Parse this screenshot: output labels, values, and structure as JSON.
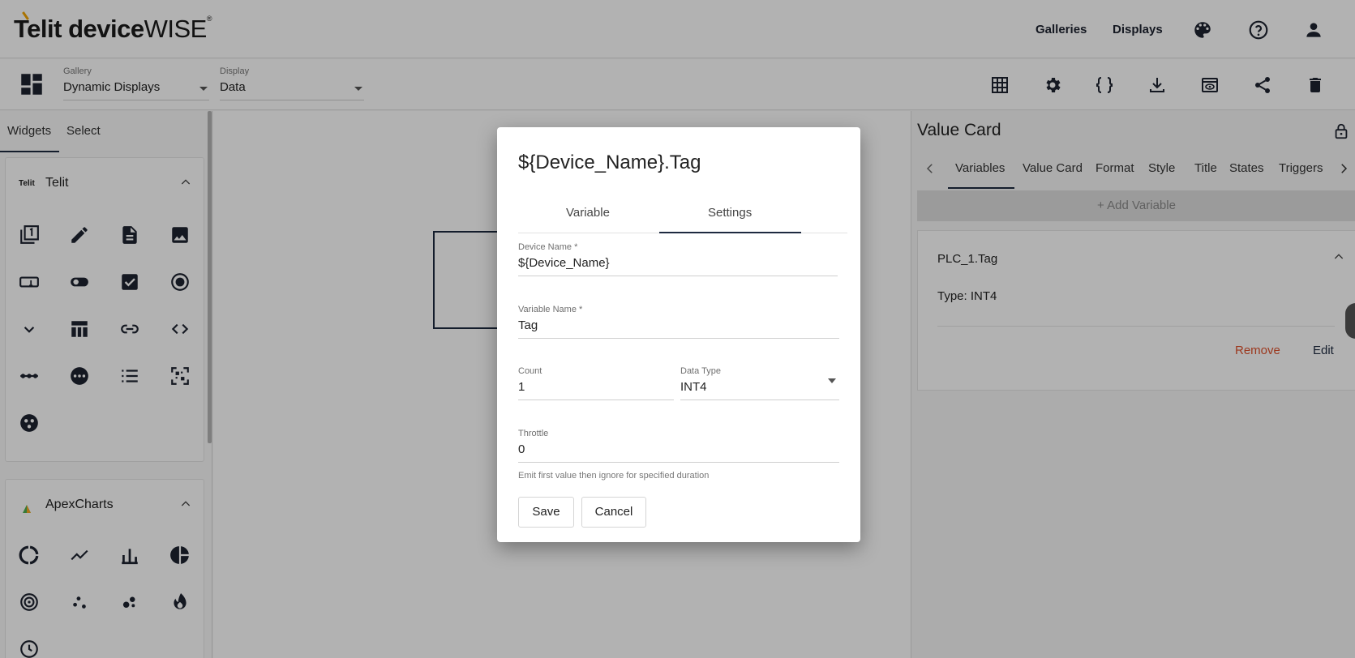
{
  "app": {
    "logo_main": "Telit",
    "logo_device": "device",
    "logo_wise": "WISE",
    "logo_reg": "®"
  },
  "topnav": {
    "galleries": "Galleries",
    "displays": "Displays",
    "icons": [
      "palette-icon",
      "help-icon",
      "account-icon"
    ]
  },
  "toolbar": {
    "gallery": {
      "label": "Gallery",
      "value": "Dynamic Displays"
    },
    "display": {
      "label": "Display",
      "value": "Data"
    },
    "icons": [
      "grid-icon",
      "settings-icon",
      "code-braces-icon",
      "download-icon",
      "preview-icon",
      "share-icon",
      "delete-icon"
    ]
  },
  "left_panel": {
    "tabs": [
      "Widgets",
      "Select"
    ],
    "groups": [
      {
        "title": "Telit",
        "logo_text": "Telit",
        "icons": [
          "copy-icon",
          "pencil-icon",
          "document-icon",
          "image-icon",
          "input-icon",
          "toggle-icon",
          "checkbox-icon",
          "radio-icon",
          "chevron-down-icon",
          "table-icon",
          "link-icon",
          "code-icon",
          "slider-icon",
          "more-icon",
          "list-icon",
          "qr-code-icon",
          "palette-icon"
        ]
      },
      {
        "title": "ApexCharts",
        "icons": [
          "donut-chart-icon",
          "line-chart-icon",
          "bar-chart-icon",
          "pie-chart-icon",
          "radial-chart-icon",
          "scatter-icon",
          "bubble-icon",
          "heatmap-icon"
        ]
      }
    ]
  },
  "right_panel": {
    "title": "Value Card",
    "tabs": [
      "Variables",
      "Value Card",
      "Format",
      "Style",
      "Title",
      "States",
      "Triggers"
    ],
    "add_variable": "+ Add Variable",
    "variable": {
      "name": "PLC_1.Tag",
      "type": "Type: INT4"
    },
    "remove": "Remove",
    "edit": "Edit"
  },
  "dialog": {
    "title": "${Device_Name}.Tag",
    "tabs": [
      "Variable",
      "Settings"
    ],
    "active_tab": "Settings",
    "device_name": {
      "label": "Device Name *",
      "value": "${Device_Name}"
    },
    "variable_name": {
      "label": "Variable Name *",
      "value": "Tag"
    },
    "count": {
      "label": "Count",
      "value": "1"
    },
    "data_type": {
      "label": "Data Type",
      "value": "INT4"
    },
    "throttle": {
      "label": "Throttle",
      "value": "0"
    },
    "hint": "Emit first value then ignore for specified duration",
    "save": "Save",
    "cancel": "Cancel"
  }
}
